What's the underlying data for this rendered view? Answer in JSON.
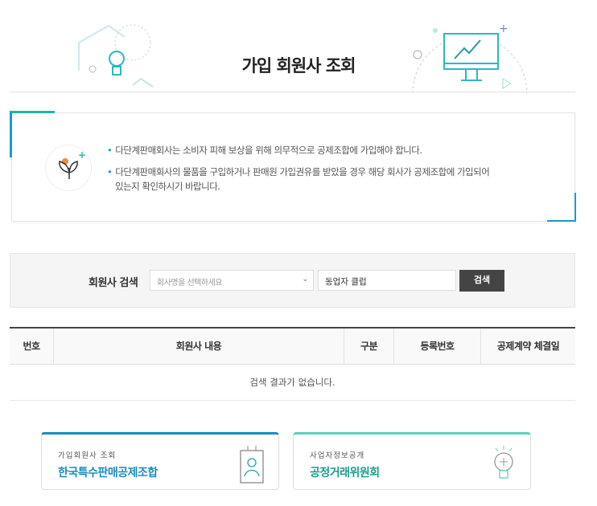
{
  "header": {
    "title": "가입 회원사 조회"
  },
  "notice": {
    "items": [
      "다단계판매회사는 소비자 피해 보상을 위해 의무적으로 공제조합에 가입해야 합니다.",
      "다단계판매회사의 물품을 구입하거나 판매원 가입권유를 받았을 경우 해당 회사가 공제조합에 가입되어",
      "있는지 확인하시기 바랍니다."
    ]
  },
  "search": {
    "label": "회원사 검색",
    "select_placeholder": "회사명을 선택하세요",
    "input_value": "동업자 클럽",
    "button": "검색"
  },
  "table": {
    "columns": [
      "번호",
      "회원사 내용",
      "구분",
      "등록번호",
      "공제계약 체결일"
    ],
    "empty": "검색 결과가 없습니다."
  },
  "cards": [
    {
      "sub": "가입회원사 조회",
      "main": "한국특수판매공제조합",
      "color": "#1a8cc0"
    },
    {
      "sub": "사업자정보공개",
      "main": "공정거래위원회",
      "color": "#1a9e8a"
    }
  ]
}
